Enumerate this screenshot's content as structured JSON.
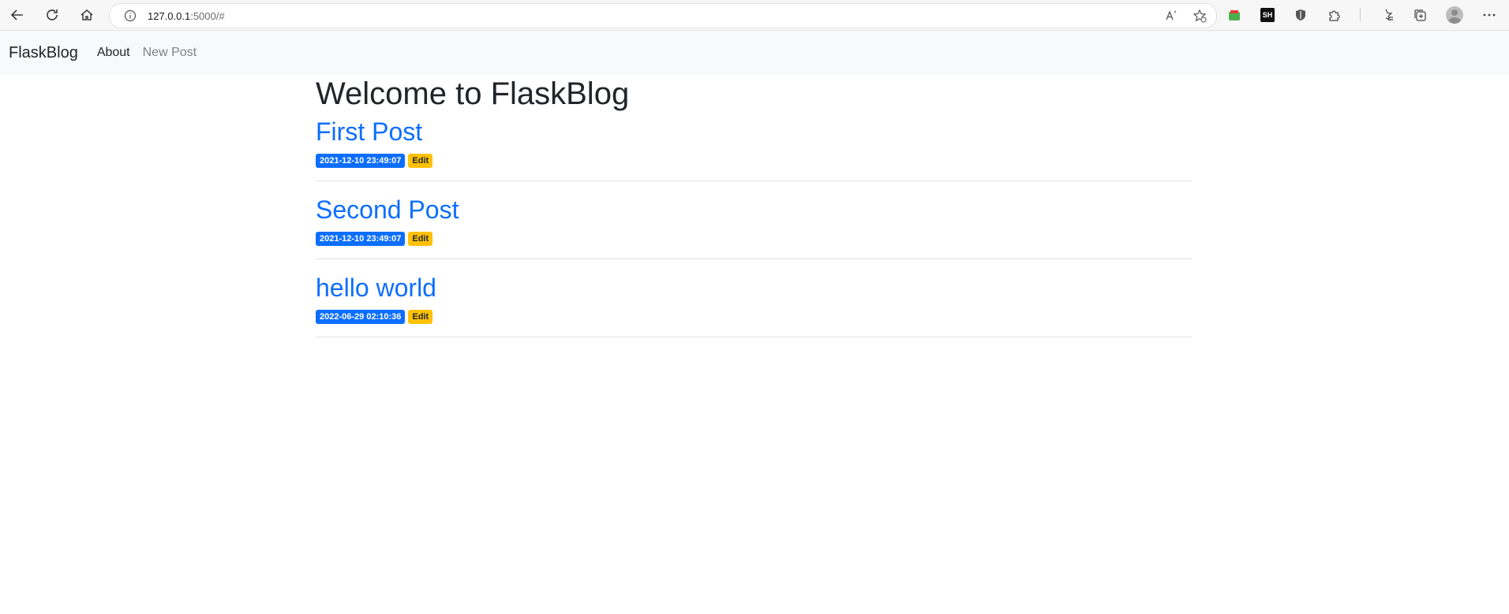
{
  "browser": {
    "url_host": "127.0.0.1",
    "url_rest": ":5000/#",
    "colors": {
      "toolbar_bg": "#f7f7f7",
      "address_bg": "#ffffff"
    },
    "icons": [
      "back-icon",
      "reload-icon",
      "home-icon",
      "info-icon",
      "read-aloud-icon",
      "add-favorite-icon",
      "extension-green-icon",
      "sh-extension-icon",
      "shield-extension-icon",
      "extensions-puzzle-icon",
      "favorites-icon",
      "collections-icon",
      "profile-avatar",
      "more-menu-icon"
    ],
    "sh_label": "SH"
  },
  "navbar": {
    "brand": "FlaskBlog",
    "links": [
      {
        "label": "About"
      },
      {
        "label": "New Post"
      }
    ],
    "bg": "#f8f9fa"
  },
  "main": {
    "title": "Welcome to FlaskBlog",
    "posts": [
      {
        "title": "First Post",
        "date": "2021-12-10 23:49:07",
        "edit_label": "Edit"
      },
      {
        "title": "Second Post",
        "date": "2021-12-10 23:49:07",
        "edit_label": "Edit"
      },
      {
        "title": "hello world",
        "date": "2022-06-29 02:10:36",
        "edit_label": "Edit"
      }
    ],
    "colors": {
      "link": "#0d6efd",
      "date_badge": "#0d6efd",
      "edit_badge": "#ffc107"
    }
  }
}
